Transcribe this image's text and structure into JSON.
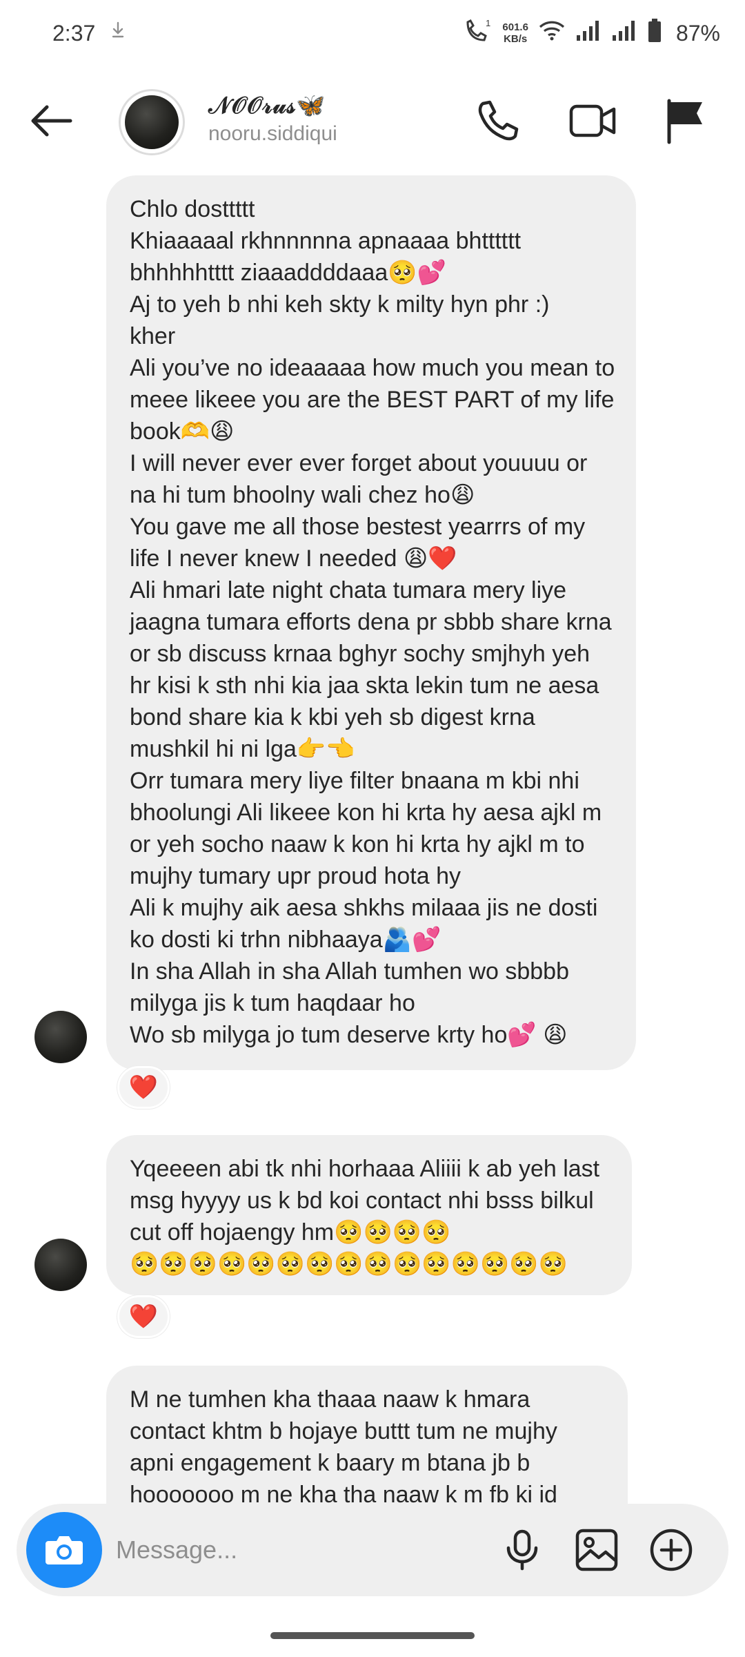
{
  "status_bar": {
    "time": "2:37",
    "net_speed_value": "601.6",
    "net_speed_unit": "KB/s",
    "battery": "87%"
  },
  "header": {
    "display_name": "𝒩𝒪𝒪𝓇𝓊𝓈🦋",
    "username": "nooru.siddiqui"
  },
  "messages": [
    {
      "text": "Chlo dosttttt\nKhiaaaaal rkhnnnnna apnaaaa bhtttttt bhhhhhtttt ziaaaddddaaa🥺💕\nAj to yeh b nhi keh skty k milty hyn phr :)\nkher\nAli you’ve no ideaaaaa how much you mean to meee likeee you are the BEST PART of my life book🫶😩\nI will never ever ever forget about youuuu or na hi tum bhoolny wali chez ho😩\nYou gave me all those bestest yearrrs of my life I never knew I needed 😩❤️\nAli hmari late night chata tumara mery liye jaagna tumara efforts dena pr sbbb share krna or sb discuss krnaa bghyr sochy smjhyh yeh hr kisi k sth nhi kia jaa skta lekin tum ne aesa bond share kia k kbi yeh sb digest krna mushkil hi ni lga👉👈\nOrr tumara mery liye filter bnaana m kbi nhi bhoolungi Ali likeee kon hi krta hy aesa ajkl m or yeh socho naaw k kon hi krta hy ajkl m to mujhy tumary upr proud hota hy\nAli k mujhy aik aesa shkhs milaaa jis ne dosti ko dosti ki trhn nibhaaya🫂💕\nIn sha Allah in sha Allah tumhen wo sbbbb milyga jis k tum haqdaar ho\nWo sb milyga jo tum deserve krty ho💕 😩",
      "reaction": "❤️"
    },
    {
      "text": "Yqeeeen abi tk nhi horhaaa Aliiii k ab yeh last msg hyyyy us k bd koi contact nhi bsss bilkul cut off hojaengy hm🥺🥺🥺🥺\n🥺🥺🥺🥺🥺🥺🥺🥺🥺🥺🥺🥺🥺🥺🥺",
      "reaction": "❤️"
    },
    {
      "text": "M ne tumhen kha thaaa naaw k hmara contact khtm b hojaye buttt tum ne mujhy apni engagement k baary m btana jb b hooooooo m ne kha tha naaw k m fb ki id",
      "reaction": ""
    }
  ],
  "composer": {
    "placeholder": "Message..."
  }
}
